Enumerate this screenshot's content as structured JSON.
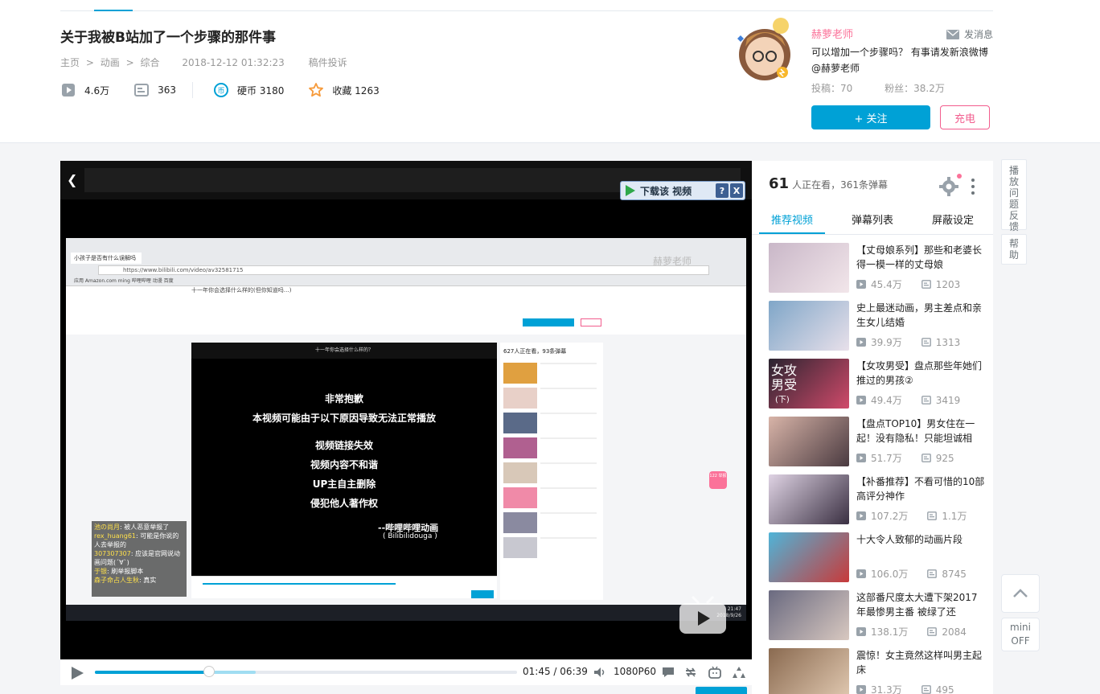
{
  "video": {
    "title": "关于我被B站加了一个步骤的那件事",
    "breadcrumb": [
      "主页",
      "动画",
      "综合"
    ],
    "breadcrumb_sep": ">",
    "date": "2018-12-12 01:32:23",
    "report": "稿件投诉",
    "views": "4.6万",
    "danmaku": "363",
    "coins": "硬币 3180",
    "favorites": "收藏 1263"
  },
  "up": {
    "name": "赫萝老师",
    "message": "发消息",
    "desc": "可以增加一个步骤吗？ 有事请发新浪微博@赫萝老师",
    "posts": "投稿：70",
    "fans": "粉丝：38.2万",
    "follow": "+ 关注",
    "charge": "充电"
  },
  "player": {
    "download": "下载该 视频",
    "download_help": "?",
    "download_close": "X",
    "watermark": "赫萝老师",
    "inner_tab": "小孩子是否有什么误解吗",
    "inner_url": "https://www.bilibili.com/video/av32581715",
    "inner_bookmarks": "应用   Amazon.com   ming   哔哩哔哩   动漫   百度",
    "inner_title": "十一年你会选择什么样的(但你知道吗…)",
    "inner_bar_title": "十一年你会选择什么样的？",
    "error_lines": [
      "非常抱歉",
      "本视频可能由于以下原因导致无法正常播放",
      "",
      "视频链接失效",
      "视频内容不和谐",
      "UP主自主删除",
      "侵犯他人著作权"
    ],
    "error_brand": "--哔哩哔哩动画",
    "error_brand_en": "( Bilibilidouga )",
    "inner_side_head": "627人正在看，93条弹幕",
    "chat": [
      {
        "user": "池の尚月",
        "text": "被人恶意举报了"
      },
      {
        "user": "rex_huang61",
        "text": "可能是你说的人去举报的"
      },
      {
        "user": "307307307",
        "text": "应该是官网说动画问题(´∀`)"
      },
      {
        "user": "于银",
        "text": "刷举报脚本"
      },
      {
        "user": "森子命占人生秋",
        "text": "真实"
      }
    ],
    "badge": "122 举报",
    "clock": "21:47\n2018/9/26",
    "current_time": "01:45",
    "duration": "06:39",
    "time_sep": "/",
    "quality": "1080P60",
    "progress_played": 0.27,
    "progress_buffered": 0.38
  },
  "panel": {
    "online_count": "61",
    "online_text": "人正在看，361条弹幕",
    "tabs": [
      "推荐视频",
      "弹幕列表",
      "屏蔽设定"
    ],
    "recommendations": [
      {
        "title": "【丈母娘系列】那些和老婆长得一模一样的丈母娘",
        "views": "45.4万",
        "danmaku": "1203",
        "colors": [
          "#c9b7c8",
          "#f2e6ea"
        ]
      },
      {
        "title": "史上最迷动画，男主差点和亲生女儿结婚",
        "views": "39.9万",
        "danmaku": "1313",
        "colors": [
          "#7fa6c8",
          "#e8e0ea"
        ]
      },
      {
        "title": "【女攻男受】盘点那些年她们推过的男孩②",
        "views": "49.4万",
        "danmaku": "3419",
        "colors": [
          "#2a2430",
          "#d04a6a"
        ],
        "thumb_text": "女攻男受",
        "thumb_sub": "(下)"
      },
      {
        "title": "【盘点TOP10】男女住在一起！没有隐私！只能坦诚相",
        "views": "51.7万",
        "danmaku": "925",
        "colors": [
          "#d8b4a8",
          "#4a3a40"
        ]
      },
      {
        "title": "【补番推荐】不看可惜的10部高评分神作",
        "views": "107.2万",
        "danmaku": "1.1万",
        "colors": [
          "#dfd3e4",
          "#3a3042"
        ]
      },
      {
        "title": "十大令人致郁的动画片段",
        "views": "106.0万",
        "danmaku": "8745",
        "colors": [
          "#4fb4d8",
          "#c83a3a"
        ]
      },
      {
        "title": "这部番尺度太大遭下架2017年最惨男主番 被绿了还",
        "views": "138.1万",
        "danmaku": "2084",
        "colors": [
          "#6a6a80",
          "#d8c8c0"
        ]
      },
      {
        "title": "震惊！女主竟然这样叫男主起床",
        "views": "31.3万",
        "danmaku": "495",
        "colors": [
          "#8a6a50",
          "#e0c8b0"
        ]
      }
    ]
  },
  "sidebar": {
    "feedback": "播放问题反馈",
    "help": "帮助",
    "mini": "mini",
    "mini_state": "OFF"
  },
  "colors": {
    "accent": "#00a1d6",
    "pink": "#fb7299"
  }
}
